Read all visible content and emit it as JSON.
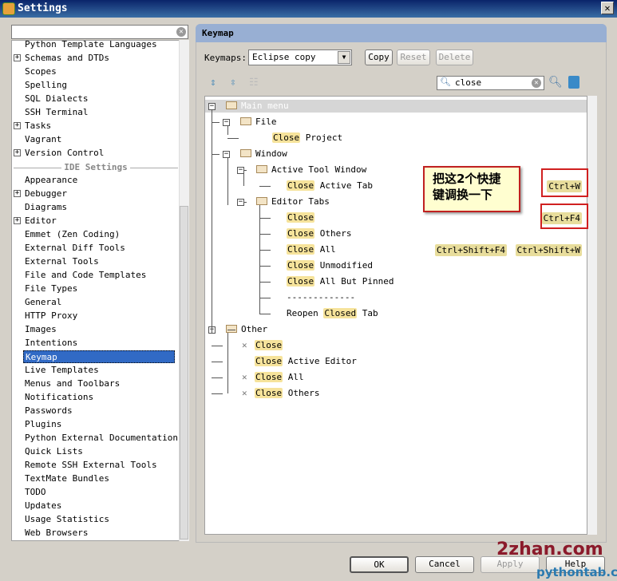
{
  "window": {
    "title": "Settings",
    "close": "✕"
  },
  "sidebar": {
    "search_value": "",
    "items": [
      {
        "label": "Python Template Languages",
        "y": 0
      },
      {
        "label": "Schemas and DTDs",
        "expand": true
      },
      {
        "label": "Scopes"
      },
      {
        "label": "Spelling"
      },
      {
        "label": "SQL Dialects"
      },
      {
        "label": "SSH Terminal"
      },
      {
        "label": "Tasks",
        "expand": true
      },
      {
        "label": "Vagrant"
      },
      {
        "label": "Version Control",
        "expand": true
      },
      {
        "section": "IDE Settings"
      },
      {
        "label": "Appearance"
      },
      {
        "label": "Debugger",
        "expand": true
      },
      {
        "label": "Diagrams"
      },
      {
        "label": "Editor",
        "expand": true
      },
      {
        "label": "Emmet (Zen Coding)"
      },
      {
        "label": "External Diff Tools"
      },
      {
        "label": "External Tools"
      },
      {
        "label": "File and Code Templates"
      },
      {
        "label": "File Types"
      },
      {
        "label": "General"
      },
      {
        "label": "HTTP Proxy"
      },
      {
        "label": "Images"
      },
      {
        "label": "Intentions"
      },
      {
        "label": "Keymap",
        "selected": true
      },
      {
        "label": "Live Templates"
      },
      {
        "label": "Menus and Toolbars"
      },
      {
        "label": "Notifications"
      },
      {
        "label": "Passwords"
      },
      {
        "label": "Plugins"
      },
      {
        "label": "Python External Documentation"
      },
      {
        "label": "Quick Lists"
      },
      {
        "label": "Remote SSH External Tools"
      },
      {
        "label": "TextMate Bundles"
      },
      {
        "label": "TODO"
      },
      {
        "label": "Updates"
      },
      {
        "label": "Usage Statistics"
      },
      {
        "label": "Web Browsers"
      }
    ]
  },
  "panel": {
    "title": "Keymap",
    "keymaps_label": "Keymaps:",
    "keymap_selected": "Eclipse copy",
    "copy": "Copy",
    "reset": "Reset",
    "delete": "Delete",
    "search_value": "close"
  },
  "tree": [
    {
      "lvl": 0,
      "text": "Main menu",
      "folder": true,
      "root": true
    },
    {
      "lvl": 1,
      "text": "File",
      "folder": true
    },
    {
      "lvl": 2,
      "m": "Close",
      "a": " Project"
    },
    {
      "lvl": 1,
      "text": "Window",
      "folder": true
    },
    {
      "lvl": 2,
      "text": "Active Tool Window",
      "folder": true
    },
    {
      "lvl": 3,
      "m": "Close",
      "a": " Active Tab",
      "sc": [
        "Ctrl+W"
      ]
    },
    {
      "lvl": 2,
      "text": "Editor Tabs",
      "folder": true
    },
    {
      "lvl": 3,
      "m": "Close",
      "a": "",
      "sc": [
        "Ctrl+F4"
      ]
    },
    {
      "lvl": 3,
      "m": "Close",
      "a": " Others"
    },
    {
      "lvl": 3,
      "m": "Close",
      "a": " All",
      "sc": [
        "Ctrl+Shift+F4",
        "Ctrl+Shift+W"
      ]
    },
    {
      "lvl": 3,
      "m": "Close",
      "a": " Unmodified"
    },
    {
      "lvl": 3,
      "m": "Close",
      "a": " All But Pinned"
    },
    {
      "lvl": 3,
      "text": "-------------"
    },
    {
      "lvl": 3,
      "b": "Reopen ",
      "m": "Closed",
      "a": " Tab"
    },
    {
      "lvl": 0,
      "text": "Other",
      "folder": true
    },
    {
      "lvl": 1,
      "m": "Close",
      "a": "",
      "x": true
    },
    {
      "lvl": 1,
      "m": "Close",
      "a": " Active Editor"
    },
    {
      "lvl": 1,
      "m": "Close",
      "a": " All",
      "x": true
    },
    {
      "lvl": 1,
      "m": "Close",
      "a": " Others",
      "x": true
    }
  ],
  "annotation": "把这2个快捷键调换一下",
  "buttons": {
    "ok": "OK",
    "cancel": "Cancel",
    "apply": "Apply",
    "help": "Help"
  },
  "watermark": {
    "line1": "2zhan.com",
    "line2": "pythontab.com"
  }
}
